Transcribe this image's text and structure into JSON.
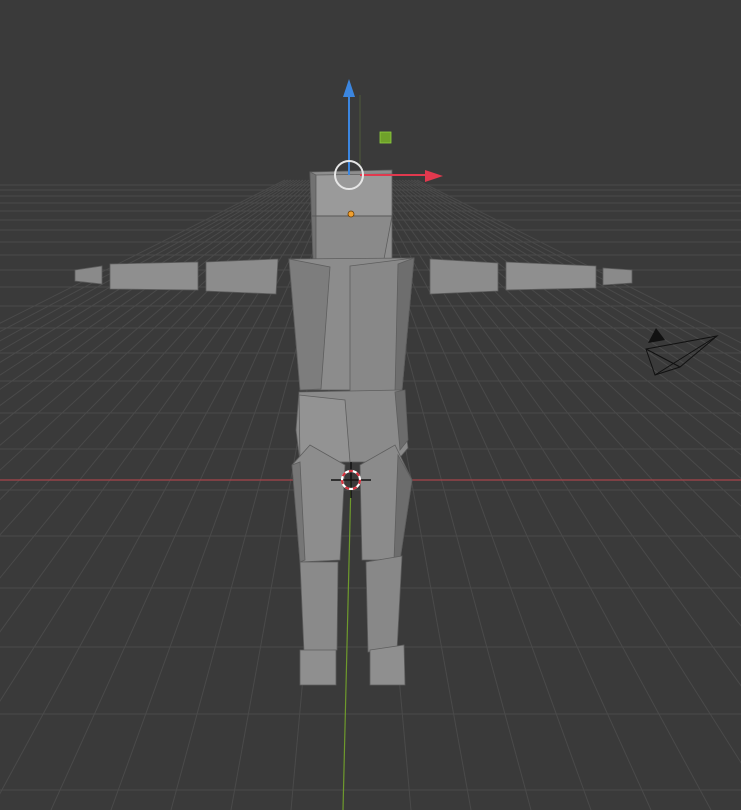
{
  "viewport": {
    "mode": "3d-viewport",
    "background": "#3a3a3a",
    "grid_color": "#4a4a4a",
    "x_axis_color": "#a6434a",
    "y_axis_color": "#6e9a2c"
  },
  "scene": {
    "mesh_color": "#8e8e8e",
    "mesh_shade_color": "#6f6f6f",
    "selected_object": "humanoid-mesh",
    "origin_color": "#f0a030"
  },
  "gizmo": {
    "x_color": "#e1394e",
    "z_color": "#3b86e0",
    "plane_handle_color": "#6fa12a",
    "rotate_ring_color": "#e6e6e6"
  },
  "icons": [
    "3d-cursor-icon",
    "camera-icon",
    "move-gizmo-icon"
  ]
}
